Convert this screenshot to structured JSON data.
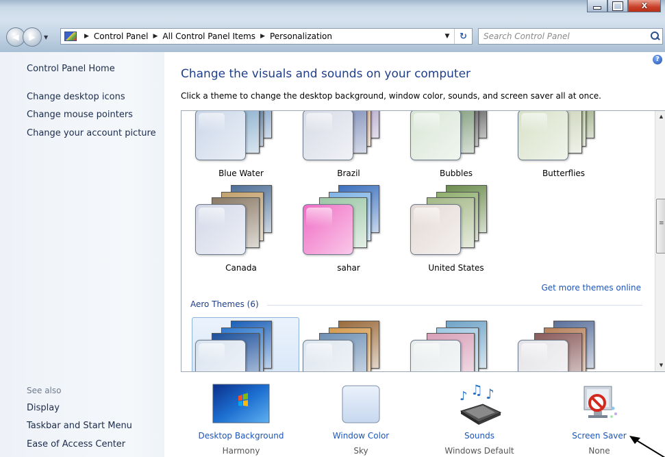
{
  "window": {
    "caption_buttons": [
      "minimize",
      "maximize",
      "close"
    ]
  },
  "address_bar": {
    "breadcrumbs": [
      "Control Panel",
      "All Control Panel Items",
      "Personalization"
    ]
  },
  "search": {
    "placeholder": "Search Control Panel"
  },
  "sidebar": {
    "home": "Control Panel Home",
    "tasks": [
      "Change desktop icons",
      "Change mouse pointers",
      "Change your account picture"
    ],
    "see_also_heading": "See also",
    "see_also": [
      "Display",
      "Taskbar and Start Menu",
      "Ease of Access Center"
    ]
  },
  "main": {
    "title": "Change the visuals and sounds on your computer",
    "description": "Click a theme to change the desktop background, window color, sounds, and screen saver all at once.",
    "my_themes": [
      {
        "name": "Blue Water",
        "swatch": "#c9d6e8",
        "pics": [
          "#5b86b8",
          "#2c5c8c",
          "#7aa3c7"
        ]
      },
      {
        "name": "Brazil",
        "swatch": "#d7dbe6",
        "pics": [
          "#9a8ab7",
          "#caa07e",
          "#6d7faf"
        ]
      },
      {
        "name": "Bubbles",
        "swatch": "#d8e6d5",
        "pics": [
          "#2a2a2a",
          "#3b3b3b",
          "#6f8f6a"
        ]
      },
      {
        "name": "Butterflies",
        "swatch": "#d7e1c8",
        "pics": [
          "#7b8f5a",
          "#a9b98a",
          "#c6cfb2"
        ]
      },
      {
        "name": "Canada",
        "swatch": "#d2d7e8",
        "pics": [
          "#4d6f96",
          "#c2a06a",
          "#8a7a66"
        ]
      },
      {
        "name": "sahar",
        "swatch": "#f06cc4",
        "pics": [
          "#3b6fbd",
          "#7fb3e5",
          "#9cc7a6"
        ]
      },
      {
        "name": "United States",
        "swatch": "#e3d9d5",
        "pics": [
          "#6b8c4d",
          "#8fae6d",
          "#a4b887"
        ]
      }
    ],
    "get_more_link": "Get more themes online",
    "aero_heading": "Aero Themes (6)",
    "aero_themes": [
      {
        "swatch": "#d9e3ef",
        "pics": [
          "#1a5fb8",
          "#2f79d0",
          "#1b4f9b"
        ]
      },
      {
        "swatch": "#dde5ee",
        "pics": [
          "#9a6a3a",
          "#d49a4d",
          "#6d8fb5"
        ]
      },
      {
        "swatch": "#e7ecec",
        "pics": [
          "#6fa3c7",
          "#a0c8e4",
          "#d8a0b8"
        ]
      },
      {
        "swatch": "#e4e4e8",
        "pics": [
          "#5a6f9a",
          "#b7805a",
          "#8a5a5a"
        ]
      }
    ]
  },
  "bottom_settings": [
    {
      "label": "Desktop Background",
      "value": "Harmony",
      "icon": "desktop-background-icon"
    },
    {
      "label": "Window Color",
      "value": "Sky",
      "icon": "window-color-icon"
    },
    {
      "label": "Sounds",
      "value": "Windows Default",
      "icon": "sounds-icon"
    },
    {
      "label": "Screen Saver",
      "value": "None",
      "icon": "screen-saver-icon"
    }
  ]
}
